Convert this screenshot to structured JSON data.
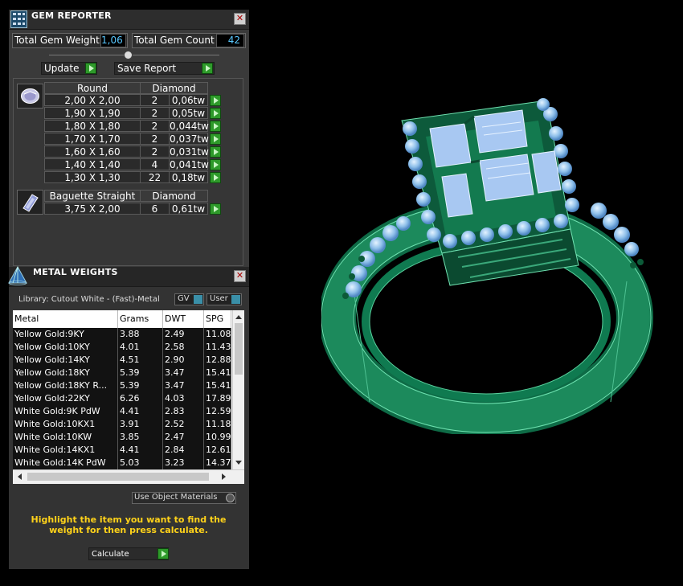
{
  "gem_reporter": {
    "title": "GEM REPORTER",
    "close": "✕",
    "total_weight_label": "Total Gem Weight",
    "total_weight_value": "1,06",
    "total_count_label": "Total Gem Count",
    "total_count_value": "42",
    "update_label": "Update",
    "save_label": "Save Report",
    "groups": [
      {
        "shape": "Round",
        "material": "Diamond",
        "rows": [
          {
            "size": "2,00 X 2,00",
            "count": "2",
            "weight": "0,06tw"
          },
          {
            "size": "1,90 X 1,90",
            "count": "2",
            "weight": "0,05tw"
          },
          {
            "size": "1,80 X 1,80",
            "count": "2",
            "weight": "0,044tw"
          },
          {
            "size": "1,70 X 1,70",
            "count": "2",
            "weight": "0,037tw"
          },
          {
            "size": "1,60 X 1,60",
            "count": "2",
            "weight": "0,031tw"
          },
          {
            "size": "1,40 X 1,40",
            "count": "4",
            "weight": "0,041tw"
          },
          {
            "size": "1,30 X 1,30",
            "count": "22",
            "weight": "0,18tw"
          }
        ]
      },
      {
        "shape": "Baguette Straight",
        "material": "Diamond",
        "rows": [
          {
            "size": "3,75 X 2,00",
            "count": "6",
            "weight": "0,61tw"
          }
        ]
      }
    ]
  },
  "metal_weights": {
    "title": "METAL WEIGHTS",
    "close": "✕",
    "library_label": "Library: Cutout White - (Fast)-Metal",
    "gv_label": "GV",
    "user_label": "User",
    "columns": [
      "Metal",
      "Grams",
      "DWT",
      "SPG"
    ],
    "rows": [
      [
        "Yellow Gold:9KY",
        "3.88",
        "2.49",
        "11.08"
      ],
      [
        "Yellow Gold:10KY",
        "4.01",
        "2.58",
        "11.43"
      ],
      [
        "Yellow Gold:14KY",
        "4.51",
        "2.90",
        "12.88"
      ],
      [
        "Yellow Gold:18KY",
        "5.39",
        "3.47",
        "15.41"
      ],
      [
        "Yellow Gold:18KY R...",
        "5.39",
        "3.47",
        "15.41"
      ],
      [
        "Yellow Gold:22KY",
        "6.26",
        "4.03",
        "17.89"
      ],
      [
        "White Gold:9K PdW",
        "4.41",
        "2.83",
        "12.59"
      ],
      [
        "White Gold:10KX1",
        "3.91",
        "2.52",
        "11.18"
      ],
      [
        "White Gold:10KW",
        "3.85",
        "2.47",
        "10.99"
      ],
      [
        "White Gold:14KX1",
        "4.41",
        "2.84",
        "12.61"
      ],
      [
        "White Gold:14K PdW",
        "5.03",
        "3.23",
        "14.37"
      ]
    ],
    "use_object_materials": "Use Object Materials",
    "instruction": "Highlight the item you want to find the weight for then press calculate.",
    "calculate_label": "Calculate"
  },
  "colors": {
    "accent_green": "#2e9a2a",
    "value_blue": "#59c8ff",
    "instruction_yellow": "#ffd21a",
    "ring_green": "#1c8a5c"
  }
}
